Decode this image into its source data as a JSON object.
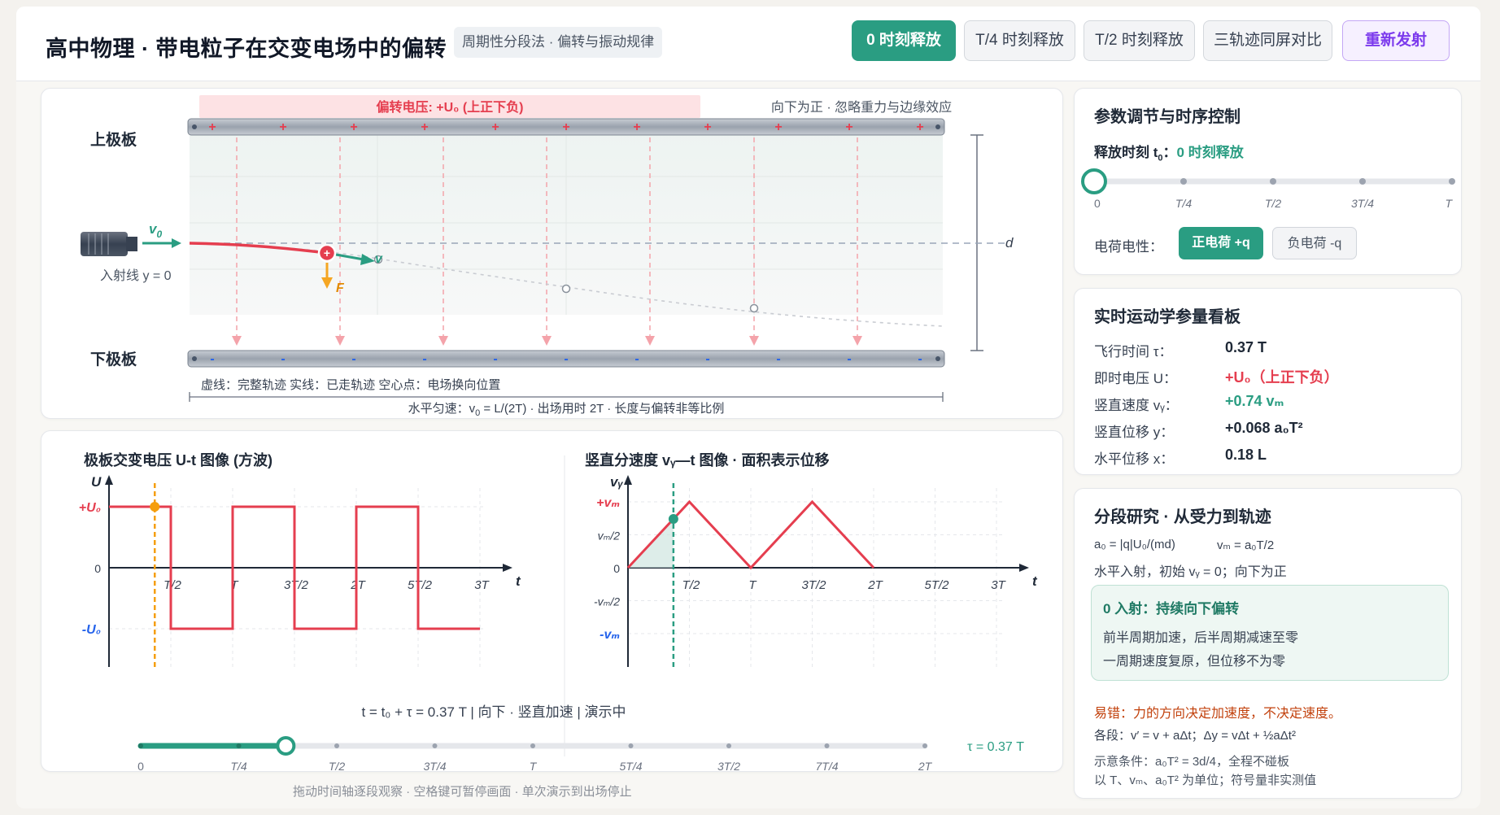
{
  "header": {
    "title": "高中物理 · 带电粒子在交变电场中的偏转",
    "subtitle": "周期性分段法 · 偏转与振动规律",
    "buttons": [
      "0 时刻释放",
      "T/4 时刻释放",
      "T/2 时刻释放",
      "三轨迹同屏对比",
      "重新发射"
    ]
  },
  "field": {
    "voltage_banner": "偏转电压: +U₀ (上正下负)",
    "direction_note": "向下为正 · 忽略重力与边缘效应",
    "top_plate": "上极板",
    "bottom_plate": "下极板",
    "v0_label": "v",
    "v0_sub": "0",
    "v_label": "v",
    "force_label": "F",
    "incident_line": "入射线 y = 0",
    "d_label": "d",
    "legend": "虚线：完整轨迹   实线：已走轨迹   空心点：电场换向位置",
    "bottom_note": "水平匀速：v",
    "bottom_note_sub": "0",
    "bottom_note_rest": " = L/(2T)   ·   出场用时 2T   ·   长度与偏转非等比例"
  },
  "ut_chart": {
    "title": "极板交变电压 U-t 图像 (方波)",
    "y_axis": "U",
    "y_ticks": [
      "+U₀",
      "0",
      "-U₀"
    ],
    "x_axis": "t",
    "x_ticks": [
      "T/2",
      "T",
      "3T/2",
      "2T",
      "5T/2",
      "3T"
    ]
  },
  "vt_chart": {
    "title": "竖直分速度 vᵧ—t 图像 · 面积表示位移",
    "y_axis": "vᵧ",
    "y_ticks": [
      "+vₘ",
      "vₘ/2",
      "0",
      "-vₘ/2",
      "-vₘ"
    ],
    "x_axis": "t",
    "x_ticks": [
      "T/2",
      "T",
      "3T/2",
      "2T",
      "5T/2",
      "3T"
    ]
  },
  "chart_data": [
    {
      "type": "line",
      "title": "极板交变电压 U-t 图像 (方波)",
      "xlabel": "t",
      "ylabel": "U",
      "x_unit": "T",
      "series": [
        {
          "name": "U",
          "points": [
            [
              0,
              1
            ],
            [
              0.5,
              1
            ],
            [
              0.5,
              -1
            ],
            [
              1,
              -1
            ],
            [
              1,
              1
            ],
            [
              1.5,
              1
            ],
            [
              1.5,
              -1
            ],
            [
              2,
              -1
            ],
            [
              2,
              1
            ],
            [
              2.5,
              1
            ],
            [
              2.5,
              -1
            ],
            [
              3,
              -1
            ]
          ]
        }
      ],
      "marker_t": 0.37,
      "ylim": [
        -1,
        1
      ],
      "xlim": [
        0,
        3
      ]
    },
    {
      "type": "line",
      "title": "竖直分速度 vᵧ—t 图像 · 面积表示位移",
      "xlabel": "t",
      "ylabel": "vᵧ",
      "x_unit": "T",
      "series": [
        {
          "name": "vᵧ",
          "points": [
            [
              0,
              0
            ],
            [
              0.5,
              1
            ],
            [
              1,
              0
            ],
            [
              1.5,
              1
            ],
            [
              2,
              0
            ]
          ]
        }
      ],
      "marker_t": 0.37,
      "ylim": [
        -1,
        1
      ],
      "xlim": [
        0,
        3
      ]
    }
  ],
  "status": {
    "text": "t = t₀ + τ = 0.37 T   |   向下 · 竖直加速   |   演示中"
  },
  "timeline": {
    "ticks": [
      "0",
      "T/4",
      "T/2",
      "3T/4",
      "T",
      "5T/4",
      "3T/2",
      "7T/4",
      "2T"
    ],
    "progress": 0.185,
    "tau_label": "τ = 0.37 T",
    "hint": "拖动时间轴逐段观察 · 空格键可暂停画面 · 单次演示到出场停止"
  },
  "params": {
    "title": "参数调节与时序控制",
    "release_label": "释放时刻 t",
    "release_sub": "0",
    "release_value": "0 时刻释放",
    "slider_ticks": [
      "0",
      "T/4",
      "T/2",
      "3T/4",
      "T"
    ],
    "slider_progress": 0,
    "charge_label": "电荷电性：",
    "positive": "正电荷 +q",
    "negative": "负电荷 -q"
  },
  "kinematics": {
    "title": "实时运动学参量看板",
    "rows": [
      {
        "label": "飞行时间 τ：",
        "value": "0.37 T"
      },
      {
        "label": "即时电压 U：",
        "value": "+U₀（上正下负）"
      },
      {
        "label": "竖直速度 vᵧ：",
        "value": "+0.74 vₘ"
      },
      {
        "label": "竖直位移 y：",
        "value": "+0.068 a₀T²"
      },
      {
        "label": "水平位移 x：",
        "value": "0.18 L"
      }
    ]
  },
  "analysis": {
    "title": "分段研究 · 从受力到轨迹",
    "formula1": "a₀ = |q|U₀/(md)",
    "formula2": "vₘ = a₀T/2",
    "line2": "水平入射，初始 vᵧ = 0；向下为正",
    "box_title": "0 入射：持续向下偏转",
    "box_line1": "前半周期加速，后半周期减速至零",
    "box_line2": "一周期速度复原，但位移不为零",
    "warning": "易错：力的方向决定加速度，不决定速度。",
    "each_segment": "各段：v′ = v + aΔt；Δy = vΔt + ½aΔt²",
    "condition1": "示意条件：a₀T² = 3d/4，全程不碰板",
    "condition2": "以 T、vₘ、a₀T² 为单位；符号量非实测值"
  },
  "colors": {
    "accent": "#2a9d82",
    "red": "#e53e4f",
    "blue": "#2563eb",
    "orange": "#f59e0b",
    "purple": "#7c3aed"
  }
}
